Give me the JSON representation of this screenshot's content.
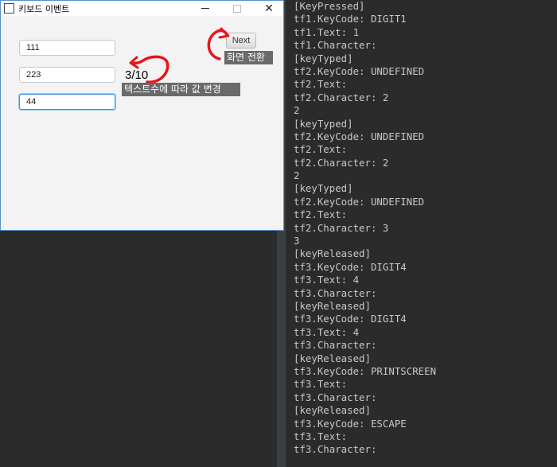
{
  "window": {
    "title": "키보드 이벤트",
    "buttons": {
      "minimize": "minimize",
      "maximize": "maximize",
      "close": "✕"
    }
  },
  "form": {
    "field1_value": "111",
    "field2_value": "223",
    "field3_value": "44",
    "next_label": "Next",
    "counter": "3/10"
  },
  "annotations": {
    "screen_change": "화면 전환",
    "value_change": "텍스트수에 따라 값 변경",
    "color": "#e8141b"
  },
  "console": {
    "lines": [
      "[KeyPressed]",
      "tf1.KeyCode: DIGIT1",
      "tf1.Text: 1",
      "tf1.Character:",
      "[keyTyped]",
      "tf2.KeyCode: UNDEFINED",
      "tf2.Text:",
      "tf2.Character: 2",
      "2",
      "[keyTyped]",
      "tf2.KeyCode: UNDEFINED",
      "tf2.Text:",
      "tf2.Character: 2",
      "2",
      "[keyTyped]",
      "tf2.KeyCode: UNDEFINED",
      "tf2.Text:",
      "tf2.Character: 3",
      "3",
      "[keyReleased]",
      "tf3.KeyCode: DIGIT4",
      "tf3.Text: 4",
      "tf3.Character:",
      "[keyReleased]",
      "tf3.KeyCode: DIGIT4",
      "tf3.Text: 4",
      "tf3.Character:",
      "[keyReleased]",
      "tf3.KeyCode: PRINTSCREEN",
      "tf3.Text:",
      "tf3.Character:",
      "[keyReleased]",
      "tf3.KeyCode: ESCAPE",
      "tf3.Text:",
      "tf3.Character:"
    ]
  },
  "colors": {
    "console_bg": "#2b2b2b",
    "console_text": "#c8c8c8",
    "window_border": "#5a8fd0",
    "focus": "#3a97e0"
  }
}
